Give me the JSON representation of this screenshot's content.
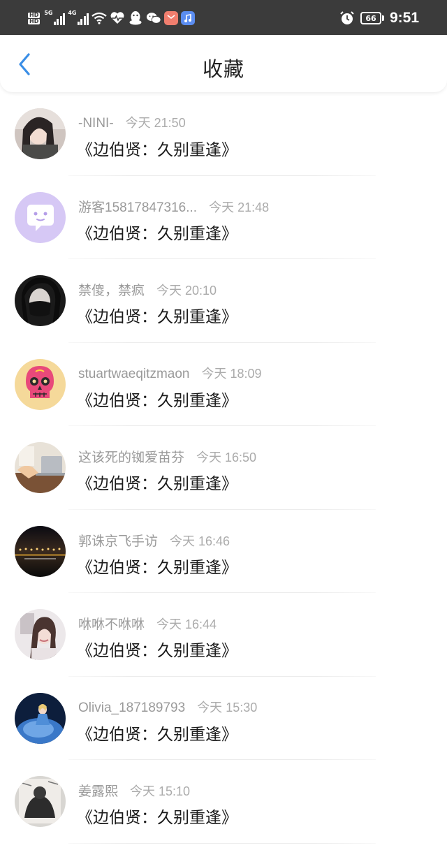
{
  "status_bar": {
    "hd_top": "HD",
    "hd_bottom": "HD",
    "net1": "5G",
    "net2": "4G",
    "battery": "66",
    "time": "9:51"
  },
  "header": {
    "title": "收藏",
    "back_icon": "chevron-left-icon"
  },
  "favorites": [
    {
      "user": "-NINI-",
      "time": "今天 21:50",
      "message": "《边伯贤：久别重逢》",
      "avatar": "photo-girl-longhair"
    },
    {
      "user": "游客15817847316...",
      "time": "今天 21:48",
      "message": "《边伯贤：久别重逢》",
      "avatar": "default-chat-purple"
    },
    {
      "user": "禁傻，禁疯",
      "time": "今天 20:10",
      "message": "《边伯贤：久别重逢》",
      "avatar": "photo-masked-face"
    },
    {
      "user": "stuartwaeqitzmaon",
      "time": "今天 18:09",
      "message": "《边伯贤：久别重逢》",
      "avatar": "pink-skull"
    },
    {
      "user": "这该死的铷爱苗芬",
      "time": "今天 16:50",
      "message": "《边伯贤：久别重逢》",
      "avatar": "photo-laptop-desk"
    },
    {
      "user": "郭诛京飞手访",
      "time": "今天 16:46",
      "message": "《边伯贤：久别重逢》",
      "avatar": "photo-night-lights"
    },
    {
      "user": "咻咻不咻咻",
      "time": "今天 16:44",
      "message": "《边伯贤：久别重逢》",
      "avatar": "photo-girl-portrait"
    },
    {
      "user": "Olivia_187189793",
      "time": "今天 15:30",
      "message": "《边伯贤：久别重逢》",
      "avatar": "photo-blue-gown"
    },
    {
      "user": "姜露熙",
      "time": "今天 15:10",
      "message": "《边伯贤：久别重逢》",
      "avatar": "photo-dark-sketch"
    }
  ],
  "colors": {
    "status_bar_bg": "#3b3b3b",
    "accent_blue": "#3a8ee6",
    "username_gray": "#9a9a9a",
    "time_gray": "#ababab",
    "default_avatar_purple": "#d6c8f5"
  }
}
